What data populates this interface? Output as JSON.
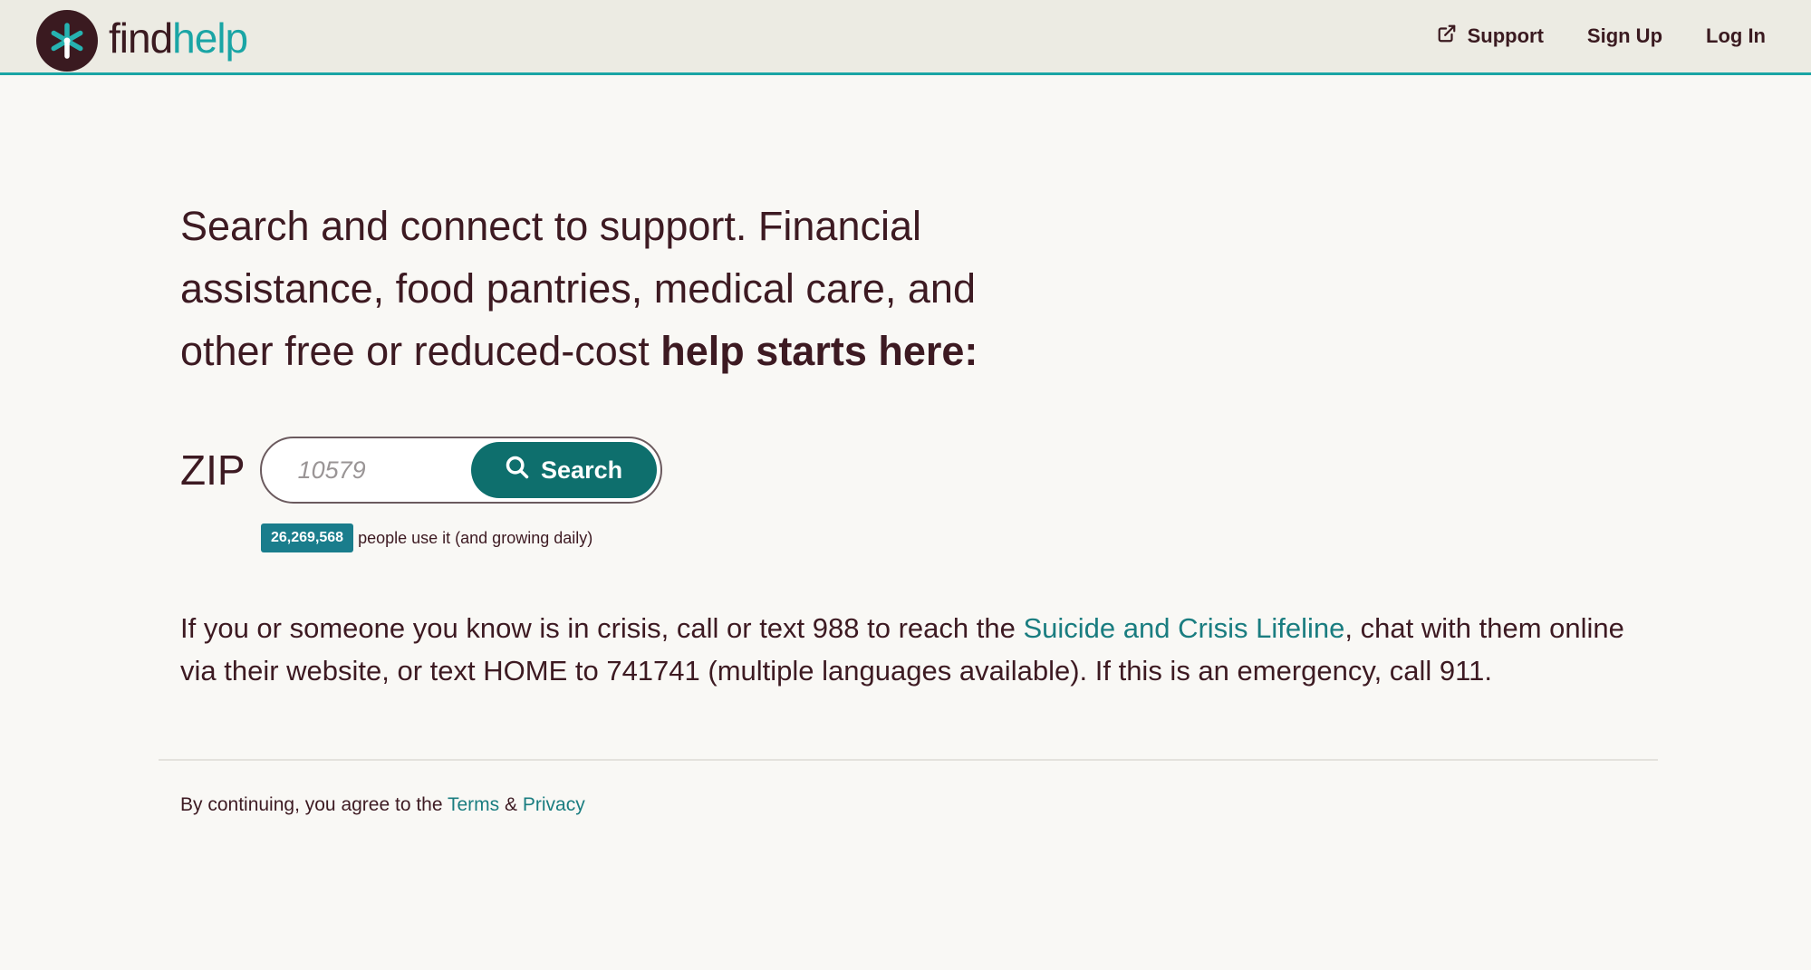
{
  "header": {
    "logo_part1": "find",
    "logo_part2": "help",
    "nav": {
      "support": "Support",
      "signup": "Sign Up",
      "login": "Log In"
    }
  },
  "hero": {
    "headline_regular": "Search and connect to support. Financial assistance, food pantries, medical care, and other free or reduced-cost ",
    "headline_bold": "help starts here:"
  },
  "search": {
    "zip_label": "ZIP",
    "placeholder": "10579",
    "button_label": "Search"
  },
  "stats": {
    "count": "26,269,568",
    "text": "people use it (and growing daily)"
  },
  "crisis": {
    "text_before": "If you or someone you know is in crisis, call or text 988 to reach the ",
    "link": "Suicide and Crisis Lifeline",
    "text_after": ", chat with them online via their website, or text HOME to 741741 (multiple languages available). If this is an emergency, call 911."
  },
  "footer": {
    "text": "By continuing, you agree to the ",
    "terms": "Terms",
    "amp": " & ",
    "privacy": "Privacy"
  },
  "colors": {
    "accent": "#1aa5a5",
    "button": "#0e6f6d",
    "badge": "#1a7d8c",
    "text": "#3d1a22",
    "header_bg": "#ecebe3",
    "page_bg": "#f9f8f5"
  },
  "icons": {
    "logo": "asterisk-logo-icon",
    "support": "external-link-icon",
    "search": "search-icon"
  }
}
